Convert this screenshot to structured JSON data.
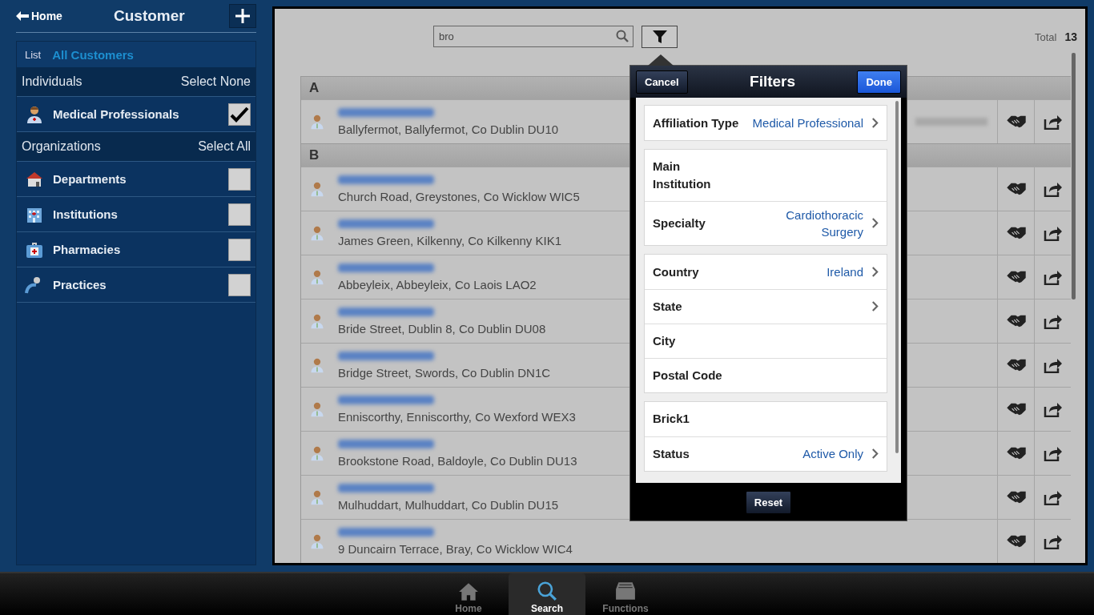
{
  "sidebar": {
    "back": "Home",
    "title": "Customer",
    "list_label": "List",
    "list_value": "All Customers",
    "groups": [
      {
        "label": "Individuals",
        "action": "Select None",
        "items": [
          {
            "label": "Medical Professionals",
            "kind": "doctor",
            "checked": true
          }
        ]
      },
      {
        "label": "Organizations",
        "action": "Select All",
        "items": [
          {
            "label": "Departments",
            "kind": "house",
            "checked": false
          },
          {
            "label": "Institutions",
            "kind": "building",
            "checked": false
          },
          {
            "label": "Pharmacies",
            "kind": "medkit",
            "checked": false
          },
          {
            "label": "Practices",
            "kind": "visitor",
            "checked": false
          }
        ]
      }
    ]
  },
  "search": {
    "value": "bro"
  },
  "total": {
    "label": "Total",
    "value": "13"
  },
  "sections": [
    {
      "letter": "A",
      "rows": [
        {
          "address": "Ballyfermot, Ballyfermot, Co Dublin DU10",
          "redacted_phone": true
        }
      ]
    },
    {
      "letter": "B",
      "rows": [
        {
          "address": "Church Road, Greystones, Co Wicklow WIC5",
          "redacted_phone": false
        },
        {
          "address": "James Green, Kilkenny, Co Kilkenny KIK1",
          "redacted_phone": false
        },
        {
          "address": "Abbeyleix, Abbeyleix, Co Laois LAO2",
          "redacted_phone": false
        },
        {
          "address": "Bride Street, Dublin 8, Co Dublin DU08",
          "redacted_phone": false
        },
        {
          "address": "Bridge Street, Swords, Co Dublin DN1C",
          "redacted_phone": false
        },
        {
          "address": "Enniscorthy, Enniscorthy, Co Wexford WEX3",
          "redacted_phone": false
        },
        {
          "address": "Brookstone Road, Baldoyle, Co Dublin DU13",
          "redacted_phone": false
        },
        {
          "address": "Mulhuddart, Mulhuddart, Co Dublin DU15",
          "redacted_phone": false
        },
        {
          "address": "9 Duncairn Terrace, Bray, Co Wicklow WIC4",
          "redacted_phone": false
        }
      ]
    }
  ],
  "filters": {
    "title": "Filters",
    "cancel": "Cancel",
    "done": "Done",
    "reset": "Reset",
    "groups": [
      [
        {
          "label": "Affiliation Type",
          "value": "Medical Professional",
          "chevron": true
        }
      ],
      [
        {
          "label": "Main Institution",
          "chevron": false
        },
        {
          "label": "Specialty",
          "value": "Cardiothoracic Surgery",
          "chevron": true
        }
      ],
      [
        {
          "label": "Country",
          "value": "Ireland",
          "chevron": true
        },
        {
          "label": "State",
          "chevron": true
        },
        {
          "label": "City",
          "chevron": false
        },
        {
          "label": "Postal Code",
          "chevron": false
        }
      ],
      [
        {
          "label": "Brick1",
          "chevron": false
        },
        {
          "label": "Status",
          "value": "Active Only",
          "chevron": true
        }
      ]
    ]
  },
  "tabbar": [
    {
      "label": "Home",
      "kind": "home",
      "selected": false
    },
    {
      "label": "Search",
      "kind": "search",
      "selected": true
    },
    {
      "label": "Functions",
      "kind": "drawer",
      "selected": false
    }
  ]
}
